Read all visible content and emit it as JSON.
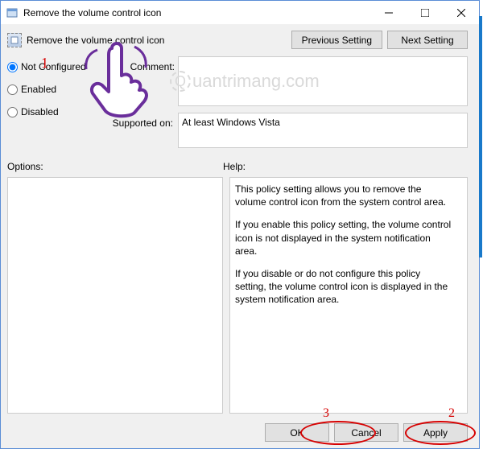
{
  "window": {
    "title": "Remove the volume control icon"
  },
  "header": {
    "setting_title": "Remove the volume control icon",
    "prev_btn": "Previous Setting",
    "next_btn": "Next Setting"
  },
  "state": {
    "not_configured": "Not Configured",
    "enabled": "Enabled",
    "disabled": "Disabled",
    "selected": "not_configured"
  },
  "comment": {
    "label": "Comment:",
    "value": ""
  },
  "supported": {
    "label": "Supported on:",
    "value": "At least Windows Vista"
  },
  "panels": {
    "options_label": "Options:",
    "help_label": "Help:"
  },
  "help": {
    "p1": "This policy setting allows you to remove the volume control icon from the system control area.",
    "p2": "If you enable this policy setting, the volume control icon is not displayed in the system notification area.",
    "p3": "If you disable or do not configure this policy setting, the volume control icon is displayed in the system notification area."
  },
  "footer": {
    "ok": "OK",
    "cancel": "Cancel",
    "apply": "Apply"
  },
  "annotations": {
    "a1": "1",
    "a2": "2",
    "a3": "3"
  },
  "watermark": "uantrimang.com"
}
